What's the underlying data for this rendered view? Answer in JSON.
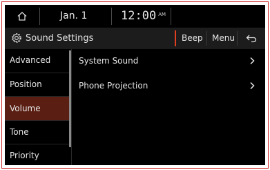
{
  "status_bar": {
    "home_icon": "home-icon",
    "date": "Jan. 1",
    "time": "12:00",
    "ampm": "AM"
  },
  "title_bar": {
    "icon": "gear-icon",
    "title": "Sound Settings",
    "beep_label": "Beep",
    "beep_accent": "#e04020",
    "menu_label": "Menu",
    "back_icon": "back-arrow-icon"
  },
  "sidebar": {
    "items": [
      {
        "label": "Advanced"
      },
      {
        "label": "Position"
      },
      {
        "label": "Volume"
      },
      {
        "label": "Tone"
      },
      {
        "label": "Priority"
      }
    ],
    "active": "Volume",
    "active_color": "#5a1e12"
  },
  "content": {
    "items": [
      {
        "label": "System Sound",
        "icon": "chevron-right-icon"
      },
      {
        "label": "Phone Projection",
        "icon": "chevron-right-icon"
      }
    ]
  }
}
